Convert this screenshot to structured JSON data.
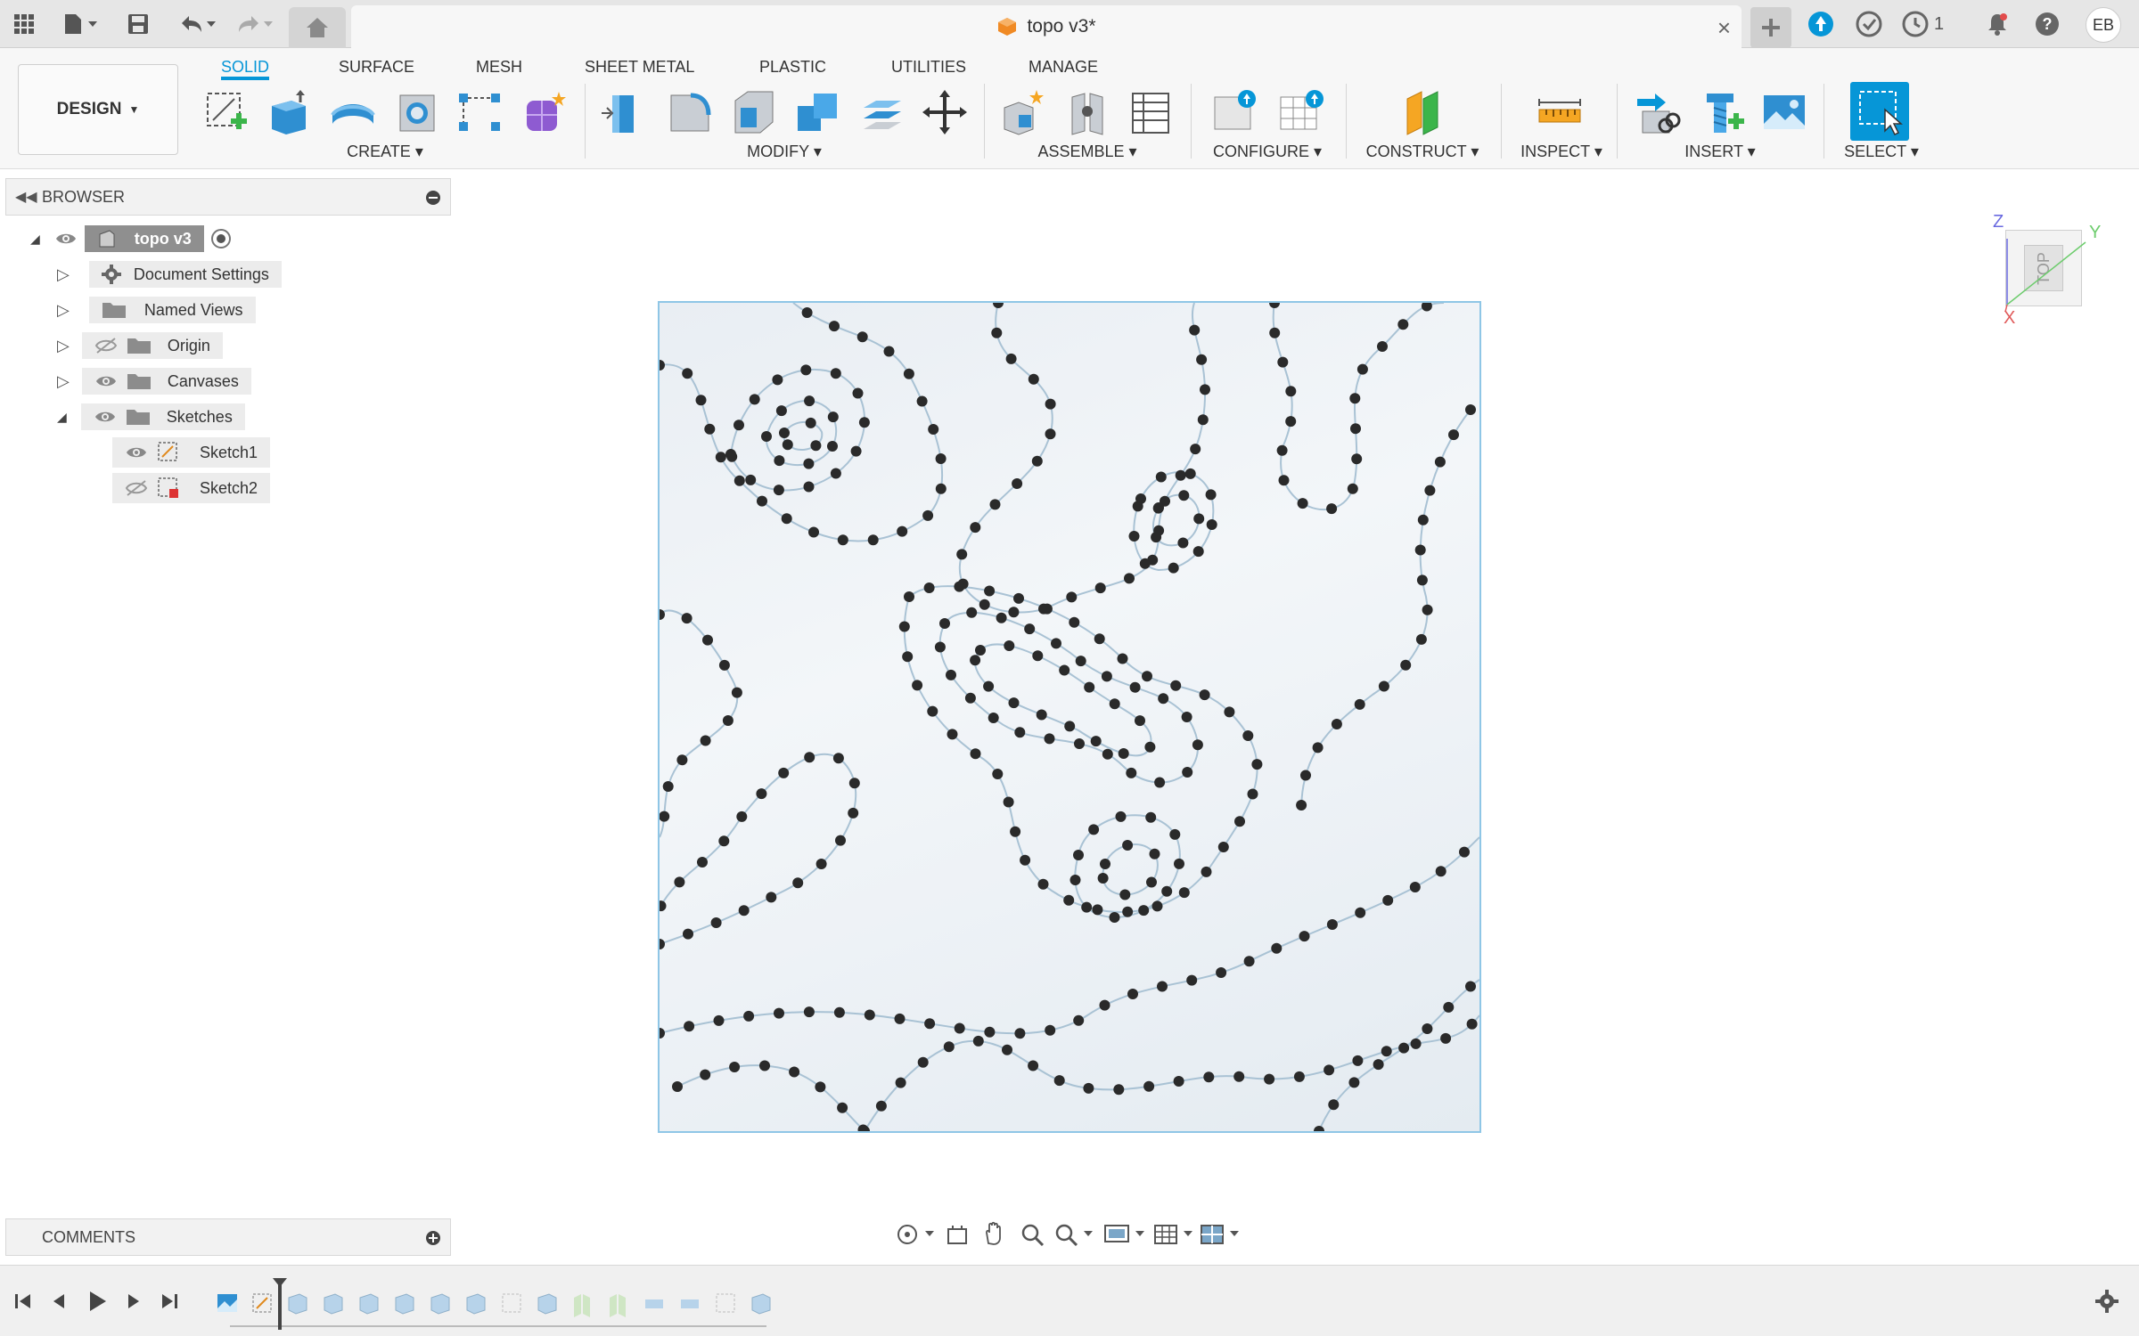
{
  "topbar": {
    "doc_title": "topo v3*",
    "jobs_count": "1",
    "user_initials": "EB"
  },
  "ribbon": {
    "tabs": [
      "SOLID",
      "SURFACE",
      "MESH",
      "SHEET METAL",
      "PLASTIC",
      "UTILITIES",
      "MANAGE"
    ],
    "workspace": "DESIGN",
    "groups": {
      "create": "CREATE",
      "modify": "MODIFY",
      "assemble": "ASSEMBLE",
      "configure": "CONFIGURE",
      "construct": "CONSTRUCT",
      "inspect": "INSPECT",
      "insert": "INSERT",
      "select": "SELECT"
    }
  },
  "browser": {
    "title": "BROWSER",
    "root": "topo v3",
    "items": [
      {
        "label": "Document Settings"
      },
      {
        "label": "Named Views"
      },
      {
        "label": "Origin"
      },
      {
        "label": "Canvases"
      },
      {
        "label": "Sketches"
      },
      {
        "label": "Sketch1"
      },
      {
        "label": "Sketch2"
      }
    ]
  },
  "comments": {
    "title": "COMMENTS"
  },
  "viewcube": {
    "face": "TOP",
    "axis_z": "Z",
    "axis_y": "Y",
    "axis_x": "X"
  },
  "colors": {
    "accent": "#0696d7",
    "board_border": "#8fc6e6",
    "point": "#2a2a2a"
  }
}
